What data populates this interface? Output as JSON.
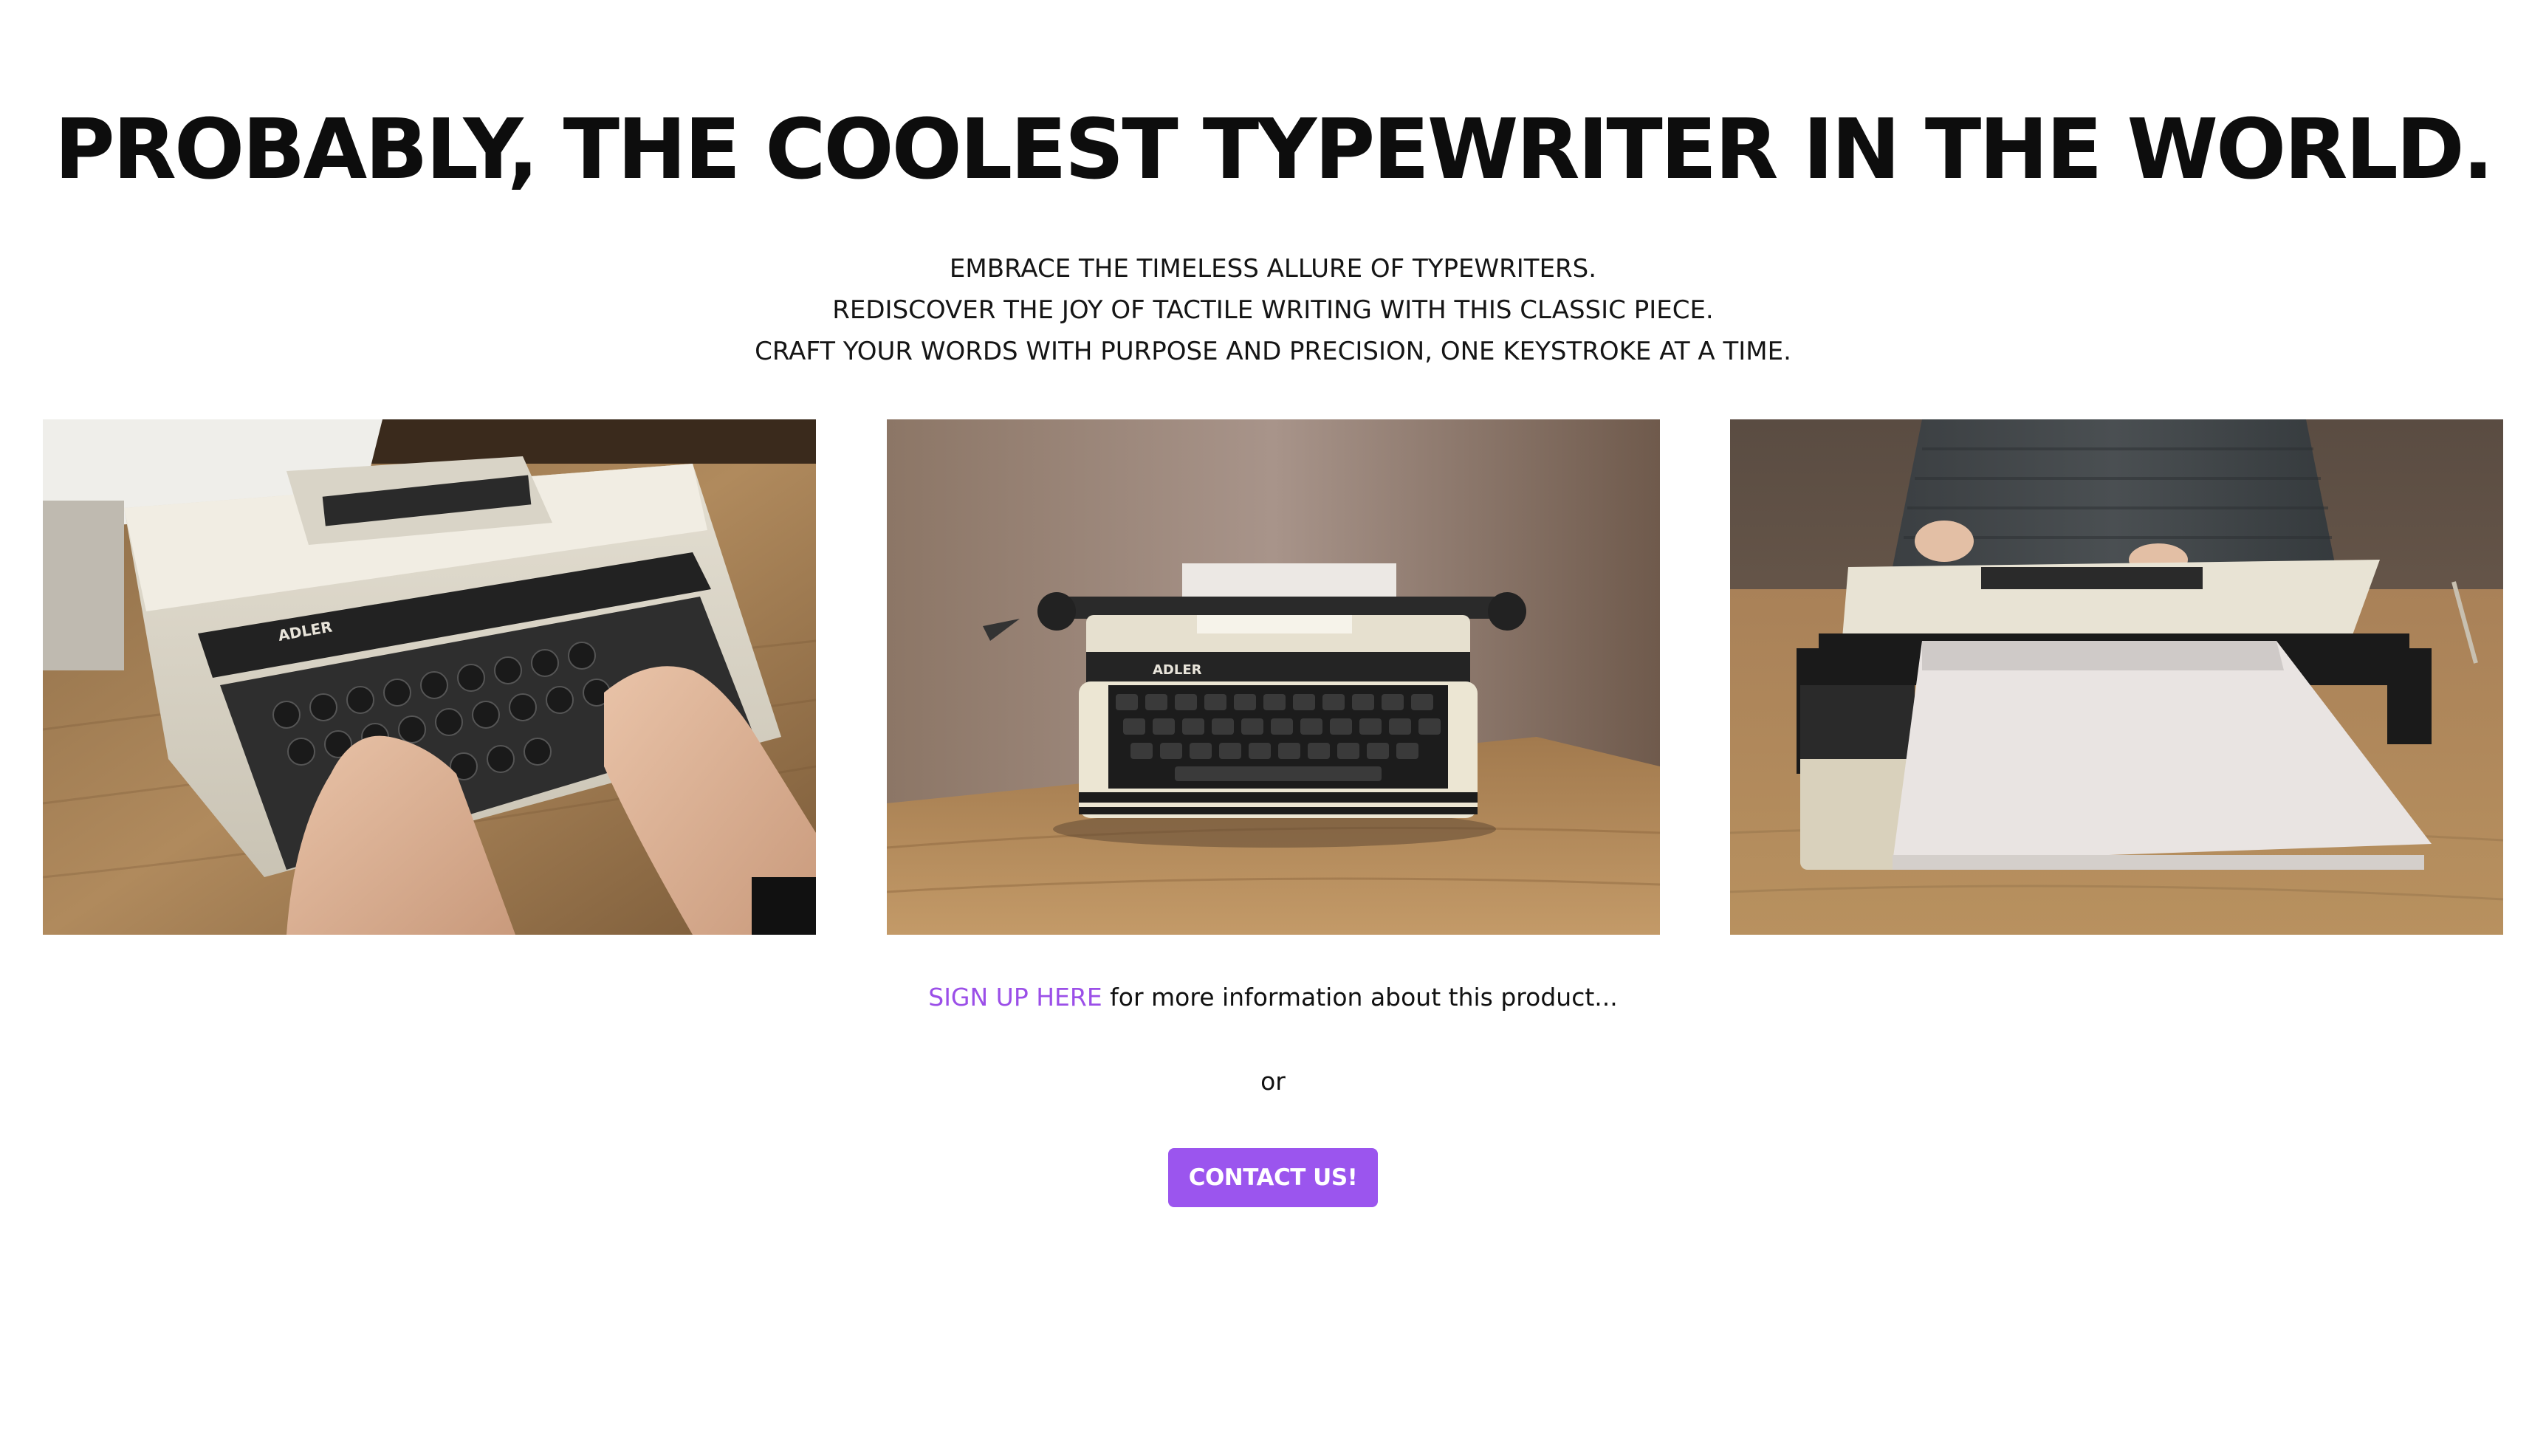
{
  "hero": {
    "title": "PROBABLY, THE COOLEST TYPEWRITER IN THE WORLD.",
    "taglines": [
      "EMBRACE THE TIMELESS ALLURE OF TYPEWRITERS.",
      "REDISCOVER THE JOY OF TACTILE WRITING WITH THIS CLASSIC PIECE.",
      "CRAFT YOUR WORDS WITH PURPOSE AND PRECISION, ONE KEYSTROKE AT A TIME."
    ]
  },
  "gallery": {
    "brand_label": "ADLER"
  },
  "cta": {
    "signup_link": "SIGN UP HERE",
    "signup_text": " for more information about this product...",
    "or_text": "or",
    "contact_button": "CONTACT US!"
  },
  "colors": {
    "accent": "#9b55ee",
    "link": "#9b4fe8",
    "text": "#111111",
    "background": "#ffffff"
  }
}
